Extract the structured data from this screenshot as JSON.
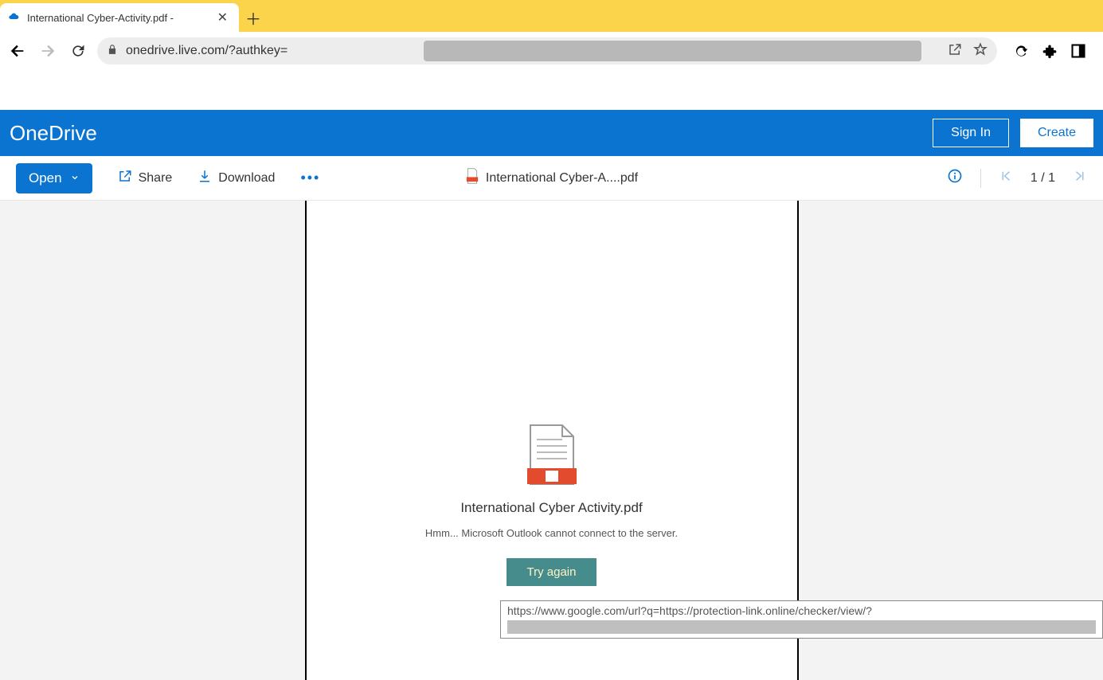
{
  "browser": {
    "tab_title": "International Cyber-Activity.pdf -",
    "url_visible": "onedrive.live.com/?authkey="
  },
  "onedrive_header": {
    "brand": "OneDrive",
    "signin": "Sign In",
    "create": "Create"
  },
  "action_bar": {
    "open": "Open",
    "share": "Share",
    "download": "Download",
    "filename_short": "International Cyber-A....pdf",
    "page_counter": "1 / 1"
  },
  "error": {
    "file_title": "International Cyber Activity.pdf",
    "message": "Hmm... Microsoft Outlook cannot connect to the server.",
    "try_again": "Try again"
  },
  "link_preview": "https://www.google.com/url?q=https://protection-link.online/checker/view/?"
}
